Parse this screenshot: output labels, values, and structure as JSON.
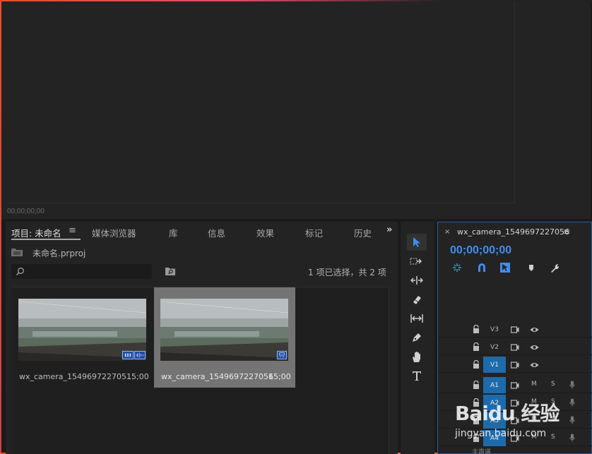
{
  "monitor": {
    "timecode": "00;00;00;00"
  },
  "project_panel": {
    "tabs": [
      {
        "label": "项目: 未命名"
      },
      {
        "label": "媒体浏览器"
      },
      {
        "label": "库"
      },
      {
        "label": "信息"
      },
      {
        "label": "效果"
      },
      {
        "label": "标记"
      },
      {
        "label": "历史"
      }
    ],
    "project_file": "未命名.prproj",
    "search": {
      "placeholder": "",
      "value": ""
    },
    "selection_status": "1 项已选择，共 2 项",
    "clips": [
      {
        "name": "wx_camera_154969722705...",
        "duration": "15;00",
        "selected": false,
        "badges": [
          "video-audio-icon",
          "audio-wave-icon"
        ]
      },
      {
        "name": "wx_camera_1549697227056",
        "duration": "15;00",
        "selected": true,
        "badges": [
          "video-only-icon"
        ]
      }
    ]
  },
  "tools": [
    "selection-tool-icon",
    "track-select-tool-icon",
    "ripple-edit-tool-icon",
    "razor-tool-icon",
    "slip-tool-icon",
    "pen-tool-icon",
    "hand-tool-icon",
    "type-tool-icon"
  ],
  "timeline": {
    "close": "×",
    "sequence_name": "wx_camera_1549697227056",
    "timecode": "00;00;00;00",
    "video_tracks": [
      {
        "name": "V3",
        "targeted": false
      },
      {
        "name": "V2",
        "targeted": false
      },
      {
        "name": "V1",
        "targeted": true
      }
    ],
    "audio_tracks": [
      {
        "name": "A1",
        "mute": "M",
        "solo": "S",
        "targeted": true
      },
      {
        "name": "A2",
        "mute": "M",
        "solo": "S",
        "targeted": true
      },
      {
        "name": "A3",
        "mute": "M",
        "solo": "S",
        "targeted": true
      },
      {
        "name": "A4",
        "mute": "M",
        "solo": "S",
        "targeted": true
      }
    ],
    "master_label": "主声道"
  },
  "watermark": {
    "logo": "Baidu 经验",
    "url": "jingyan.baidu.com"
  },
  "colors": {
    "accent": "#2d8ceb",
    "track_target": "#1e6bab",
    "selected_clip": "#747474"
  }
}
